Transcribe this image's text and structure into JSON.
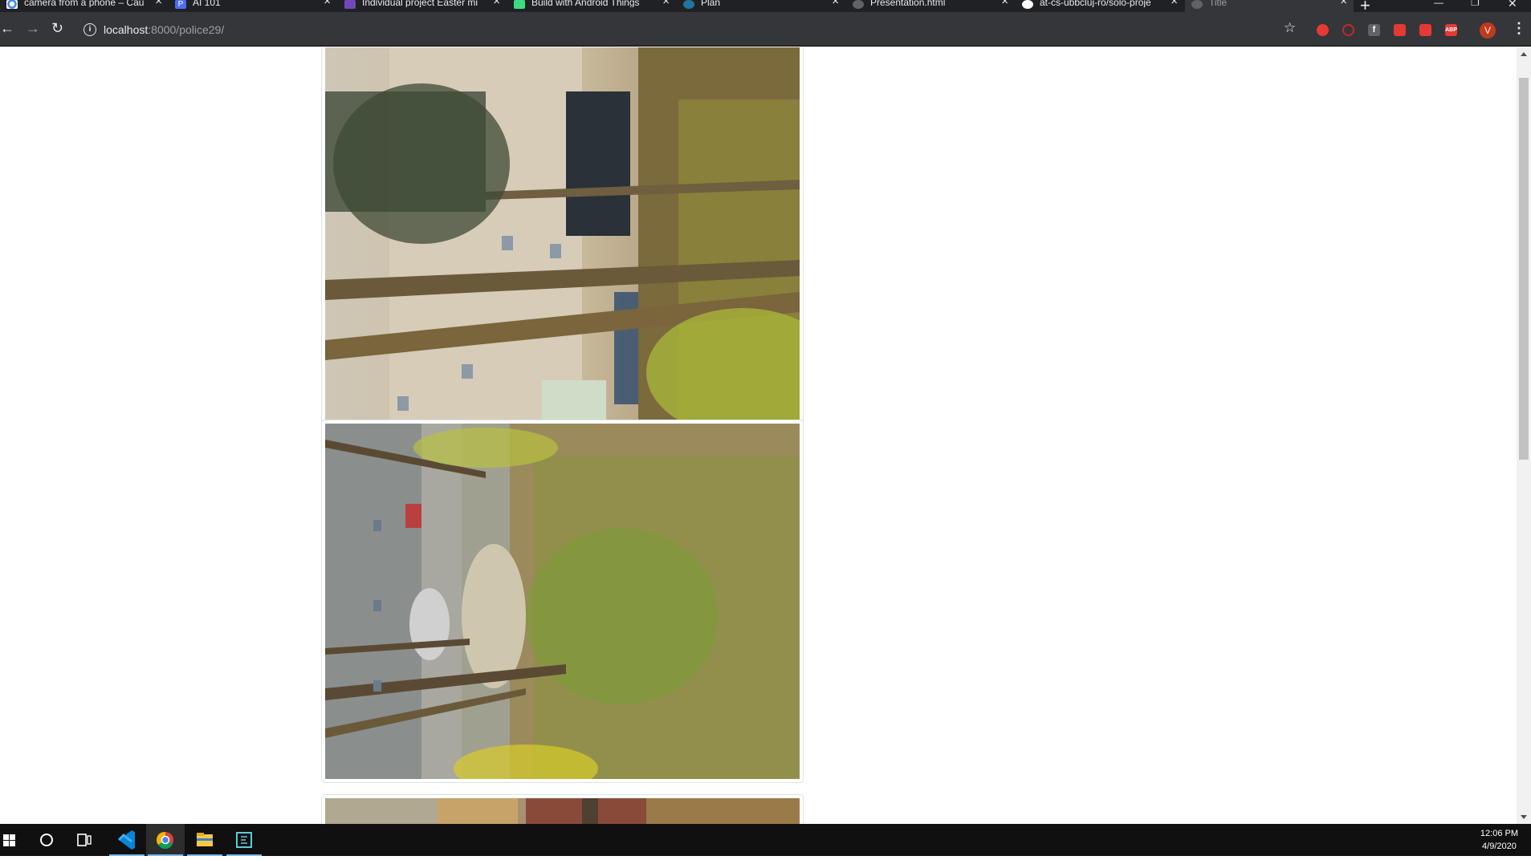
{
  "browser": {
    "tabs": [
      {
        "title": "camera from a phone – Cau",
        "favicon": "google-icon",
        "color": "#4285f4"
      },
      {
        "title": "AI 101",
        "favicon": "p-icon",
        "color": "#4a6cf7"
      },
      {
        "title": "Individual project Easter mi",
        "favicon": "forms-icon",
        "color": "#7248b9"
      },
      {
        "title": "Build with Android Things",
        "favicon": "android-icon",
        "color": "#3ddc84"
      },
      {
        "title": "Plan",
        "favicon": "wordpress-icon",
        "color": "#21759b"
      },
      {
        "title": "Presentation.html",
        "favicon": "globe-icon",
        "color": "#5f6368"
      },
      {
        "title": "at-cs-ubbcluj-ro/solo-proje",
        "favicon": "github-icon",
        "color": "#ffffff"
      },
      {
        "title": "Title",
        "favicon": "globe-icon",
        "color": "#5f6368",
        "active": true
      }
    ],
    "url_host": "localhost",
    "url_rest": ":8000/police29/",
    "profile_initial": "V",
    "extensions": [
      {
        "name": "stop-extension-icon",
        "color": "#e53935",
        "label": ""
      },
      {
        "name": "no-sign-extension-icon",
        "color": "#c62828",
        "label": ""
      },
      {
        "name": "facebook-extension-icon",
        "color": "#5f6368",
        "label": "f"
      },
      {
        "name": "video-extension-icon",
        "color": "#e53935",
        "label": ""
      },
      {
        "name": "pdf-extension-icon",
        "color": "#e53935",
        "label": ""
      },
      {
        "name": "adblock-extension-icon",
        "color": "#e53935",
        "label": "ABP"
      }
    ]
  },
  "page": {
    "photos": [
      {
        "name": "photo-1",
        "alt": "rotated photo of trees and apartment building"
      },
      {
        "name": "photo-2",
        "alt": "rotated photo of trees, grass and parked cars"
      },
      {
        "name": "photo-3",
        "alt": "rotated photo, partially visible"
      }
    ]
  },
  "taskbar": {
    "time": "12:06 PM",
    "date": "4/9/2020",
    "apps": [
      "start-icon",
      "search-icon",
      "task-view-icon",
      "vscode-icon",
      "chrome-icon",
      "file-explorer-icon",
      "terminal-icon"
    ]
  }
}
